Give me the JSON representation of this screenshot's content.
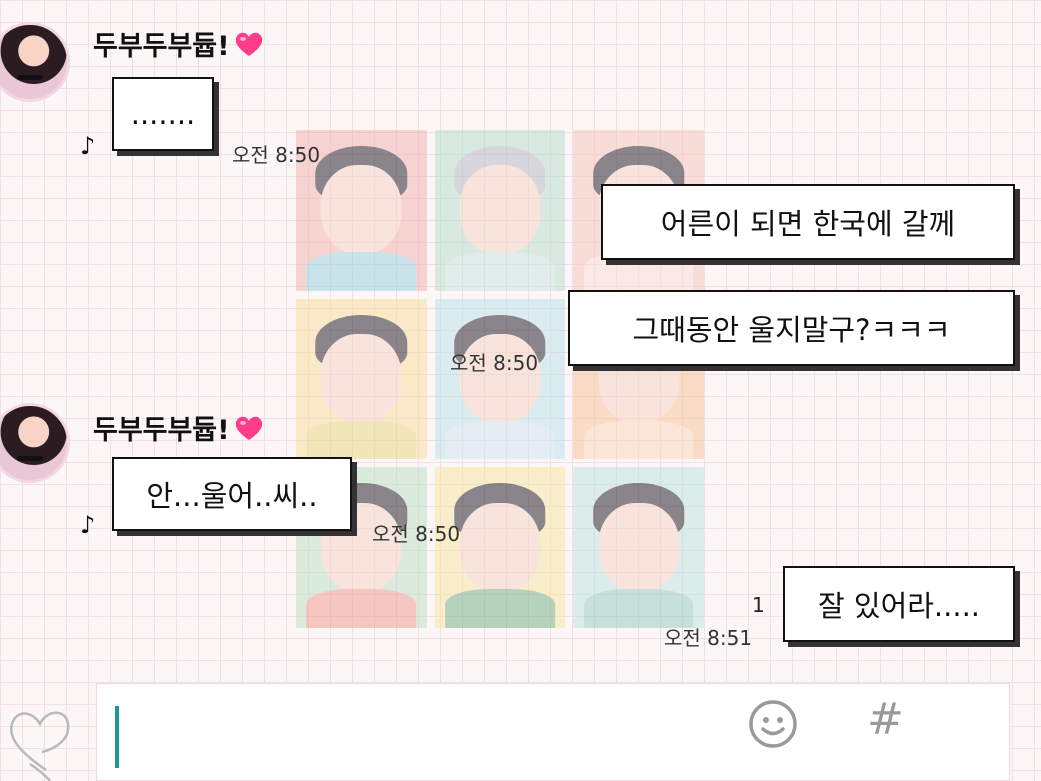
{
  "chat": {
    "messages": [
      {
        "sender": "두부두부듑!",
        "text": ".......",
        "time": "오전 8:50"
      },
      {
        "text": "어른이 되면 한국에 갈께"
      },
      {
        "text": "그때동안 울지말구?ㅋㅋㅋ",
        "time": "오전 8:50"
      },
      {
        "sender": "두부두부듑!",
        "text": "안...울어..씨..",
        "time": "오전 8:50"
      },
      {
        "text": "잘 있어라.....",
        "time": "오전 8:51",
        "unread": "1"
      }
    ]
  },
  "icons": {
    "sender_heart": "pink-heart-icon",
    "note": "music-note-icon",
    "emoji": "smiley-icon",
    "hash": "hash-icon",
    "deco": "heart-doodle-icon"
  },
  "input": {
    "hash_label": "#"
  },
  "colors": {
    "caret": "#1e9a8c",
    "heart": "#ff3d8b",
    "background_grid": "#f1dfe3"
  }
}
